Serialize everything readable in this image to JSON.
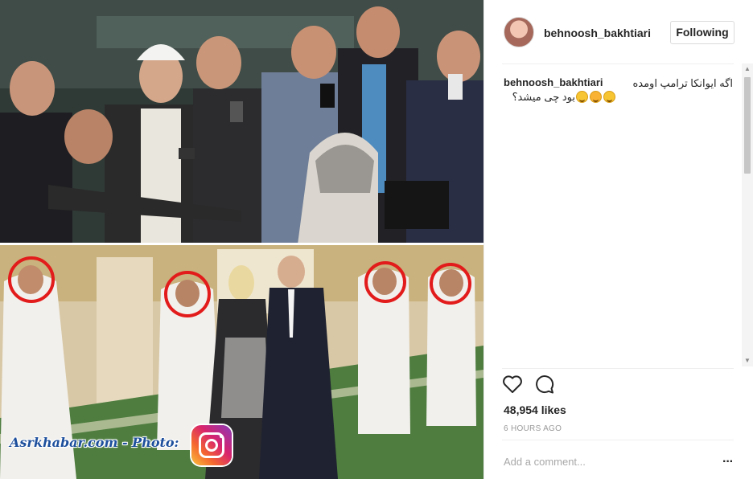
{
  "post": {
    "watermark": "Asrkhabar.com - Photo:",
    "image_icon": "instagram-logo-icon"
  },
  "header": {
    "username": "behnoosh_bakhtiari",
    "follow_label": "Following"
  },
  "caption": {
    "username": "behnoosh_bakhtiari",
    "line1": "اگه ایوانکا ترامپ اومده",
    "line2": "بود چی میشد؟",
    "emoji": [
      "grimacing-face",
      "face-with-tears-of-joy",
      "grimacing-face"
    ]
  },
  "actions": {
    "like_icon": "heart-icon",
    "comment_icon": "speech-bubble-icon"
  },
  "stats": {
    "likes": "48,954 likes",
    "time": "6 HOURS AGO"
  },
  "comment_box": {
    "placeholder": "Add a comment...",
    "more_icon": "more-options-icon",
    "more_label": "···"
  },
  "colors": {
    "text": "#262626",
    "muted": "#999999",
    "circle_highlight": "#e21b1b",
    "watermark": "#1d4f9c"
  }
}
